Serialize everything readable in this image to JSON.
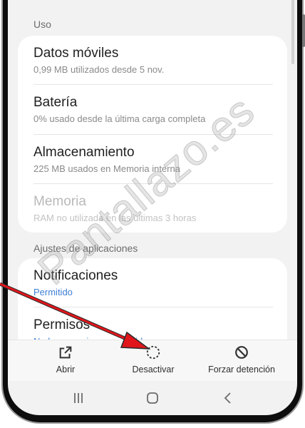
{
  "sections": {
    "uso_label": "Uso",
    "app_settings_label": "Ajustes de aplicaciones"
  },
  "usage_items": [
    {
      "title": "Datos móviles",
      "subtitle": "0,99 MB utilizados desde 5 nov."
    },
    {
      "title": "Batería",
      "subtitle": "0% usado desde la última carga completa"
    },
    {
      "title": "Almacenamiento",
      "subtitle": "225 MB usados en Memoria interna"
    },
    {
      "title": "Memoria",
      "subtitle": "RAM no utilizada en las últimas 3 horas"
    }
  ],
  "settings_items": [
    {
      "title": "Notificaciones",
      "subtitle": "Permitido"
    },
    {
      "title": "Permisos",
      "subtitle": "No hay permisos concedidos"
    }
  ],
  "actions": {
    "open": "Abrir",
    "disable": "Desactivar",
    "force_stop": "Forzar detención"
  },
  "watermark": "Pantallazo.es",
  "icons": {
    "open": "open-external-icon",
    "disable": "dashed-circle-icon",
    "force_stop": "no-entry-icon",
    "recents": "recents-icon",
    "home": "home-icon",
    "back": "back-icon"
  },
  "colors": {
    "link": "#3e7fd6",
    "arrow": "#e0161b",
    "screen_bg": "#f2f2f2",
    "card_bg": "#ffffff"
  }
}
